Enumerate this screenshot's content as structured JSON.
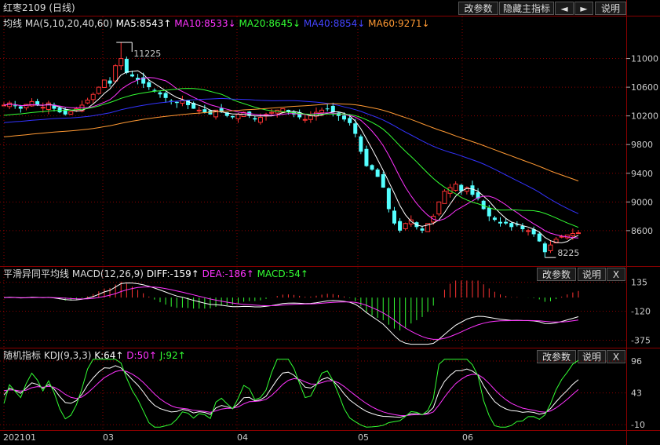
{
  "title": "红枣2109 (日线)",
  "toolbar": {
    "params": "改参数",
    "hide_main": "隐藏主指标",
    "prev": "◄",
    "next": "►",
    "help": "说明"
  },
  "main_legend": {
    "name": "均线",
    "ma_params": "MA(5,10,20,40,60)",
    "ma5": "MA5:8543↑",
    "ma10": "MA10:8533↓",
    "ma20": "MA20:8645↓",
    "ma40": "MA40:8854↓",
    "ma60": "MA60:9271↓"
  },
  "macd_legend": {
    "name": "平滑异同平均线",
    "params": "MACD(12,26,9)",
    "diff": "DIFF:-159↑",
    "dea": "DEA:-186↑",
    "macd": "MACD:54↑"
  },
  "kdj_legend": {
    "name": "随机指标",
    "params": "KDJ(9,3,3)",
    "k": "K:64↑",
    "d": "D:50↑",
    "j": "J:92↑"
  },
  "panel_buttons": {
    "params": "改参数",
    "help": "说明",
    "close": "X"
  },
  "annotations": {
    "high": "11225",
    "low": "8225"
  },
  "x_labels": [
    "202101",
    "03",
    "04",
    "05",
    "06"
  ],
  "colors": {
    "up": "#ff3333",
    "down": "#54ffff",
    "ma5": "#ffffff",
    "ma10": "#ff33ff",
    "ma20": "#33ff33",
    "ma40": "#3333ff",
    "ma60": "#ff9933",
    "grid": "#8a0000"
  },
  "chart_data": [
    {
      "type": "candlestick",
      "title": "红枣2109 (日线)",
      "y_ticks": [
        11000,
        10600,
        10200,
        9800,
        9400,
        9000,
        8600
      ],
      "ylim": [
        8150,
        11400
      ],
      "x_ticks": [
        "202101",
        "03",
        "04",
        "05",
        "06"
      ],
      "ohlc_close_path": [
        10350,
        10380,
        10340,
        10300,
        10360,
        10400,
        10350,
        10320,
        10380,
        10300,
        10250,
        10220,
        10260,
        10300,
        10350,
        10420,
        10500,
        10600,
        10700,
        10650,
        10900,
        11000,
        10800,
        10750,
        10700,
        10650,
        10600,
        10550,
        10500,
        10450,
        10400,
        10380,
        10420,
        10350,
        10300,
        10280,
        10250,
        10220,
        10280,
        10250,
        10200,
        10180,
        10220,
        10250,
        10200,
        10150,
        10180,
        10220,
        10250,
        10280,
        10300,
        10260,
        10220,
        10180,
        10150,
        10200,
        10250,
        10280,
        10300,
        10250,
        10200,
        10150,
        10100,
        9950,
        9700,
        9500,
        9450,
        9350,
        9200,
        8900,
        8700,
        8600,
        8700,
        8750,
        8650,
        8600,
        8700,
        8800,
        9000,
        9150,
        9200,
        9250,
        9150,
        9200,
        9100,
        9050,
        8900,
        8800,
        8750,
        8700,
        8700,
        8650,
        8680,
        8620,
        8600,
        8550,
        8450,
        8300,
        8400,
        8480,
        8520,
        8540,
        8560,
        8570
      ],
      "high_label": 11225,
      "low_label": 8225,
      "ma_last": {
        "MA5": 8543,
        "MA10": 8533,
        "MA20": 8645,
        "MA40": 8854,
        "MA60": 9271
      }
    },
    {
      "type": "bar",
      "title": "MACD(12,26,9)",
      "y_ticks": [
        135,
        -120,
        -375
      ],
      "ylim": [
        -420,
        160
      ],
      "last": {
        "DIFF": -159,
        "DEA": -186,
        "MACD": 54
      }
    },
    {
      "type": "line",
      "title": "KDJ(9,3,3)",
      "y_ticks": [
        96,
        43,
        -10
      ],
      "ylim": [
        -15,
        100
      ],
      "last": {
        "K": 64,
        "D": 50,
        "J": 92
      }
    }
  ]
}
